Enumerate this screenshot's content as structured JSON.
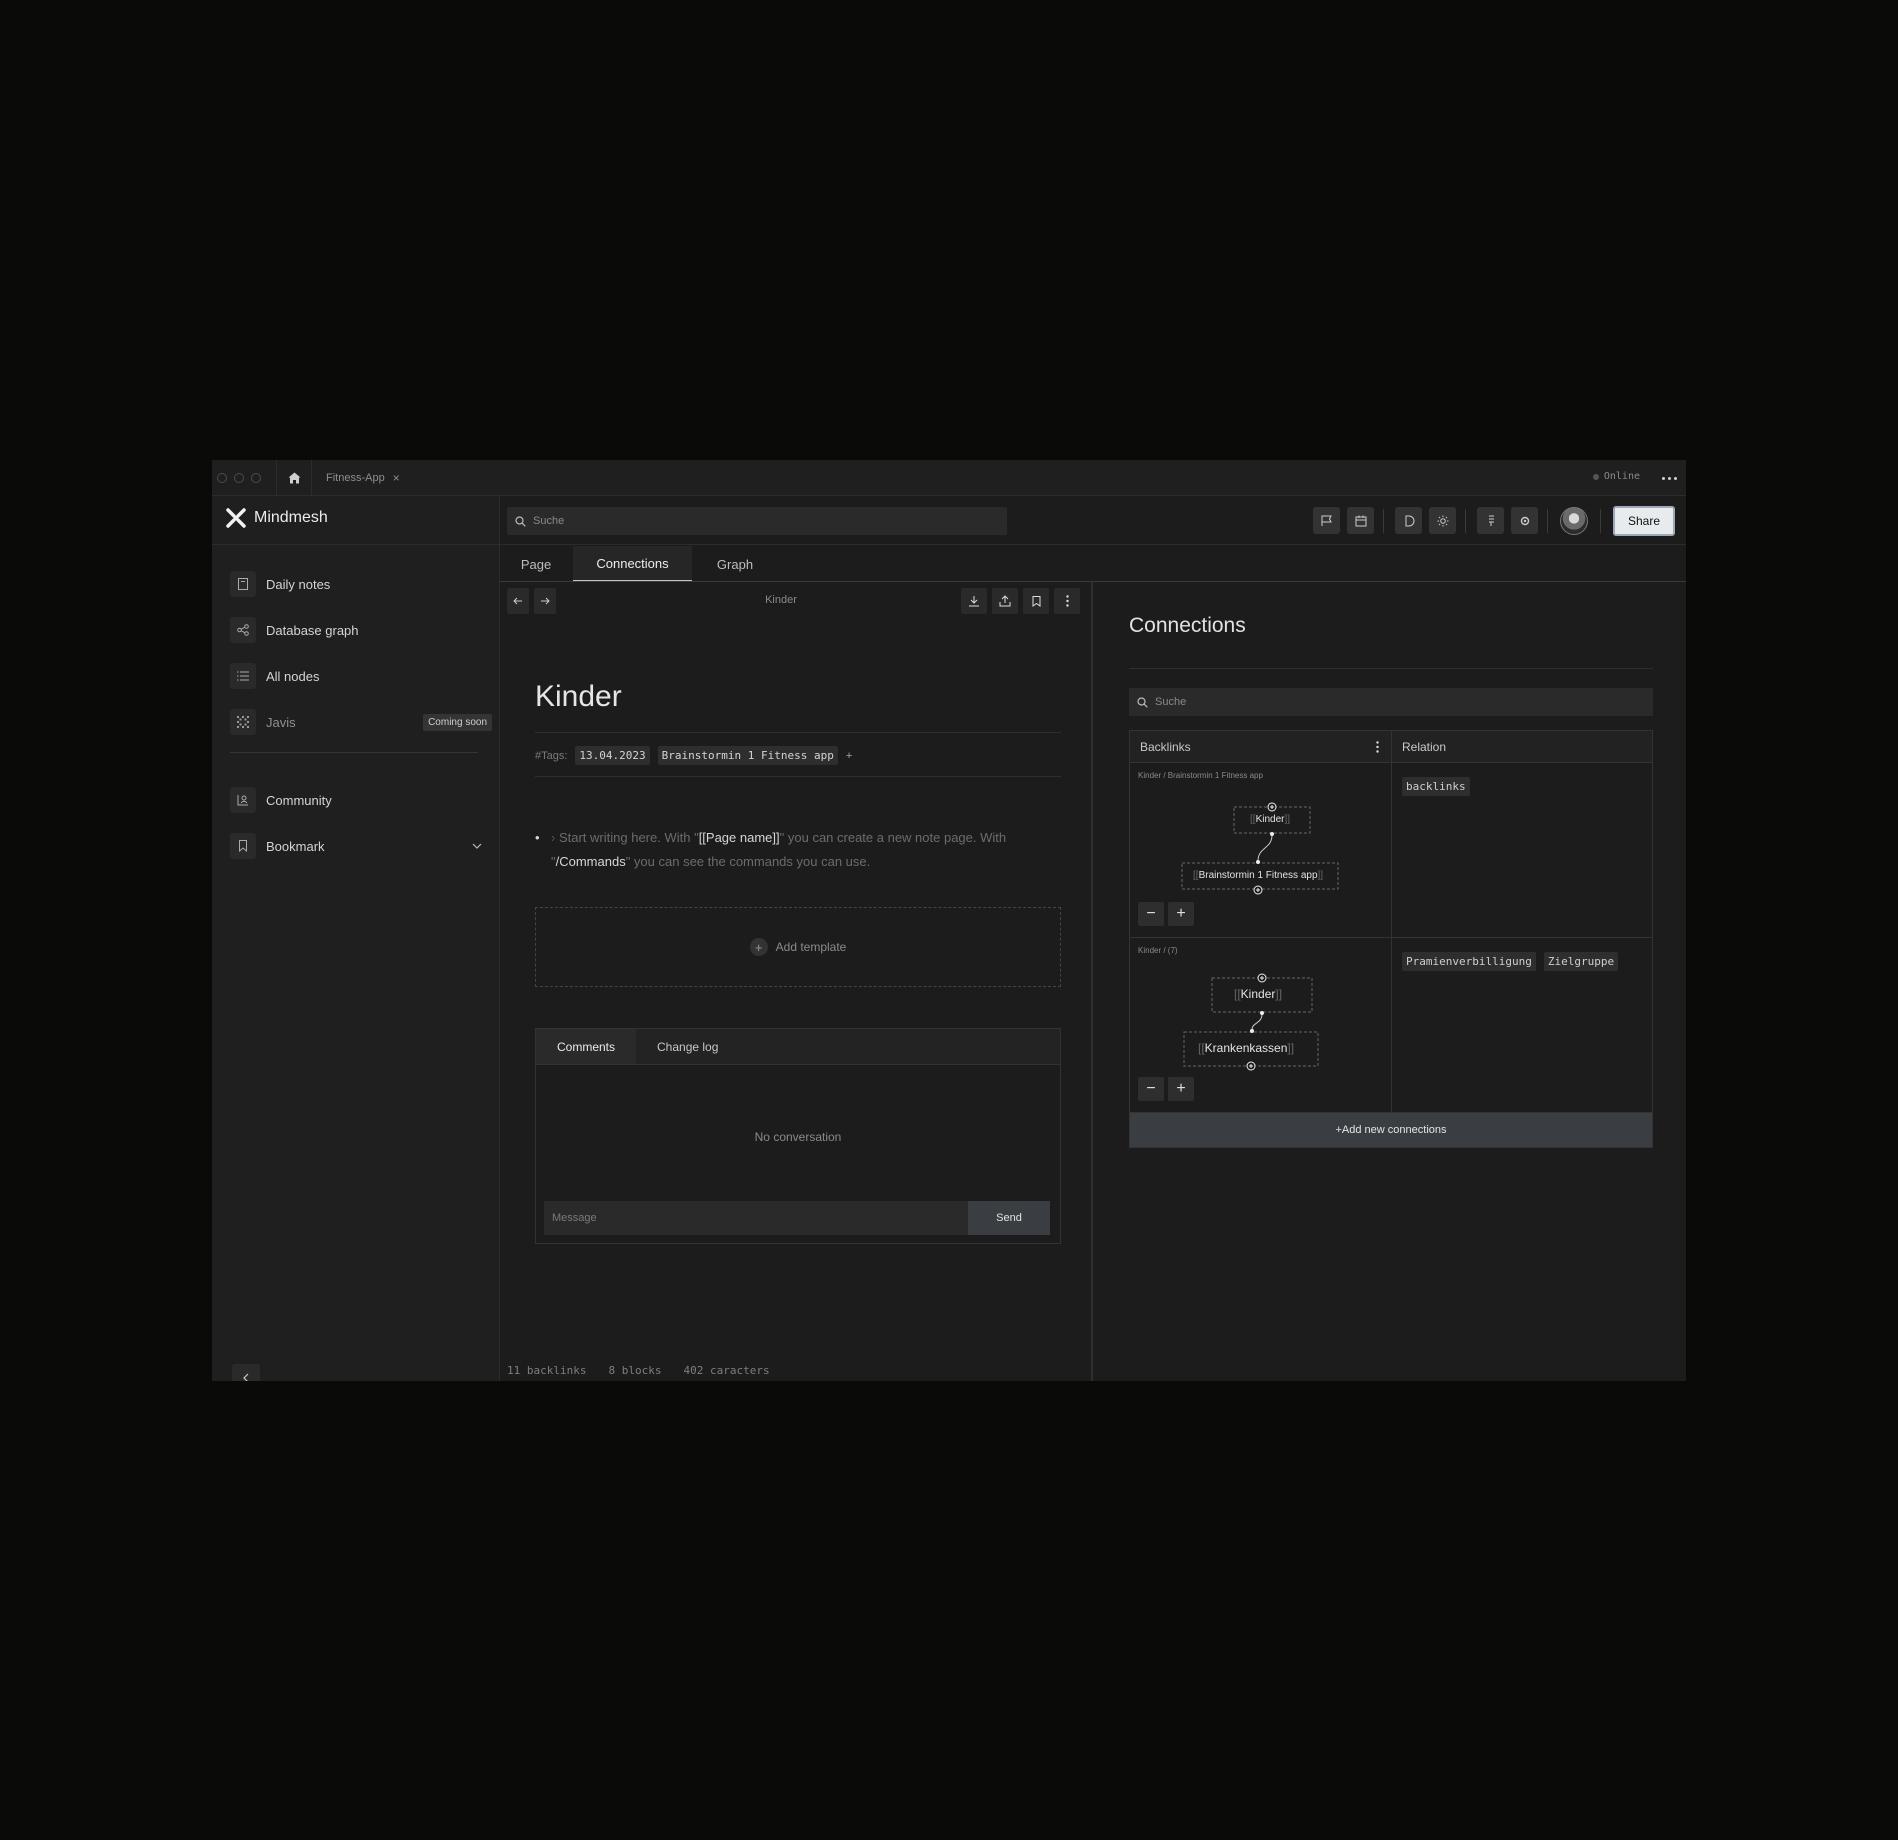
{
  "titlebar": {
    "tab_title": "Fitness-App",
    "tab_close": "×",
    "status": "Online"
  },
  "sidebar": {
    "brand": "Mindmesh",
    "items": [
      {
        "label": "Daily notes",
        "icon": "daily-notes-icon"
      },
      {
        "label": "Database graph",
        "icon": "database-graph-icon"
      },
      {
        "label": "All nodes",
        "icon": "list-icon"
      },
      {
        "label": "Javis",
        "icon": "javis-icon",
        "badge": "Coming soon"
      }
    ],
    "secondary_items": [
      {
        "label": "Community",
        "icon": "community-icon"
      },
      {
        "label": "Bookmark",
        "icon": "bookmark-icon"
      }
    ]
  },
  "header": {
    "search_placeholder": "Suche",
    "share_label": "Share"
  },
  "tabs": [
    {
      "label": "Page",
      "active": false
    },
    {
      "label": "Connections",
      "active": true
    },
    {
      "label": "Graph",
      "active": false
    }
  ],
  "editor": {
    "breadcrumb": "Kinder",
    "title": "Kinder",
    "tags_label": "#Tags:",
    "tags": [
      "13.04.2023",
      "Brainstormin 1 Fitness app"
    ],
    "tag_add": "+",
    "placeholder_part1": "Start writing here. With \"",
    "placeholder_hl1": "[[Page name]]",
    "placeholder_part2": "\" you can create a new note page. With \"",
    "placeholder_hl2": "/Commands",
    "placeholder_part3": "\" you can see the commands you can use.",
    "add_template": "Add template",
    "comments": {
      "tabs": [
        "Comments",
        "Change log"
      ],
      "empty": "No conversation",
      "message_placeholder": "Message",
      "send": "Send"
    },
    "stats": [
      "11 backlinks",
      "8 blocks",
      "402 caracters"
    ]
  },
  "connections": {
    "title": "Connections",
    "search_placeholder": "Suche",
    "headers": [
      "Backlinks",
      "Relation"
    ],
    "rows": [
      {
        "crumb": "Kinder / Brainstormin 1 Fitness app",
        "node_top": "Kinder",
        "node_bottom": "Brainstormin 1 Fitness app",
        "relations": [
          "backlinks"
        ]
      },
      {
        "crumb": "Kinder / (7)",
        "node_top": "Kinder",
        "node_bottom": "Krankenkassen",
        "relations": [
          "Pramienverbilligung",
          "Zielgruppe"
        ]
      }
    ],
    "zoom_out": "−",
    "zoom_in": "+",
    "add_label": "+Add new connections"
  },
  "colors": {
    "background": "#0a0a09",
    "app": "#1c1c1c",
    "accent": "#bfc6ce",
    "share": "#e8ebee"
  }
}
